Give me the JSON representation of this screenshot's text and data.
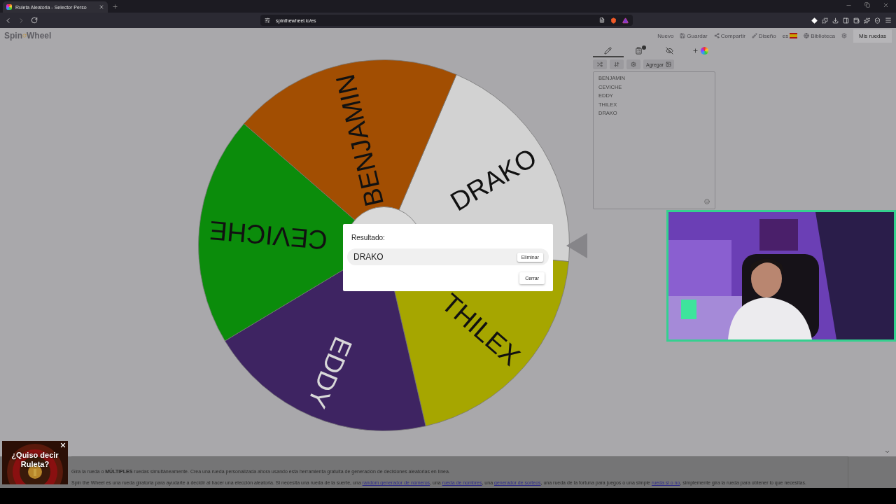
{
  "browser": {
    "tab": {
      "title": "Ruleta Aleatoria - Selector Perso"
    },
    "url": "spinthewheel.io/es"
  },
  "nav": {
    "logo": [
      "Spin",
      "Wheel"
    ],
    "items": [
      {
        "kind": "new",
        "label": "Nuevo"
      },
      {
        "kind": "save",
        "label": "Guardar"
      },
      {
        "kind": "share",
        "label": "Compartir"
      },
      {
        "kind": "design",
        "label": "Diseño"
      },
      {
        "kind": "language",
        "label": "es"
      },
      {
        "kind": "library",
        "label": "Biblioteca"
      },
      {
        "kind": "settings"
      }
    ],
    "my_wheels": "Mis ruedas"
  },
  "wheel": {
    "segments": [
      {
        "label": "DRAKO",
        "color": "#d2d2d2"
      },
      {
        "label": "THILEX",
        "color": "#a6a600"
      },
      {
        "label": "EDDY",
        "color": "#3e2462"
      },
      {
        "label": "CEVICHE",
        "color": "#0b8c0b"
      },
      {
        "label": "BENJAMIN",
        "color": "#a24e02"
      }
    ]
  },
  "dialog": {
    "title": "Resultado:",
    "result": "DRAKO",
    "remove": "Eliminar",
    "close": "Cerrar"
  },
  "panel": {
    "tabs": [
      {
        "kind": "edit",
        "selected": true
      },
      {
        "kind": "results",
        "selected": false,
        "notification": true
      },
      {
        "kind": "hide",
        "selected": false
      },
      {
        "kind": "add_color",
        "selected": false
      }
    ],
    "tools": [
      {
        "kind": "shuffle"
      },
      {
        "kind": "sort"
      },
      {
        "kind": "settings"
      },
      {
        "kind": "add",
        "label": "Agregar"
      }
    ],
    "entries": [
      "BENJAMIN",
      "CEVICHE",
      "EDDY",
      "THILEX",
      "DRAKO"
    ]
  },
  "ad": {
    "text": "¿Quiso decir Ruleta?"
  },
  "footer": {
    "paragraphs": [
      [
        {
          "kind": "text",
          "text": "Gira la rueda o **MÚLTIPLES** ruedas simultáneamente. Crea una rueda personalizada ahora usando esta herramienta gratuita de generación de decisiones aleatorias en línea."
        }
      ],
      [
        {
          "kind": "text",
          "text": "Spin the Wheel es una rueda giratoria para ayudarte a decidir al hacer una elección aleatoria. Si necesita una rueda de la suerte, una "
        },
        {
          "kind": "link",
          "text": "random generador de números"
        },
        {
          "kind": "text",
          "text": ", una "
        },
        {
          "kind": "link",
          "text": "rueda de nombres"
        },
        {
          "kind": "text",
          "text": ", una "
        },
        {
          "kind": "link",
          "text": "generador de sorteos"
        },
        {
          "kind": "text",
          "text": ", una rueda de la fortuna para juegos o una simple "
        },
        {
          "kind": "link",
          "text": "rueda si o no"
        },
        {
          "kind": "text",
          "text": ", simplemente gira la rueda para obtener lo que necesitas."
        }
      ]
    ]
  }
}
